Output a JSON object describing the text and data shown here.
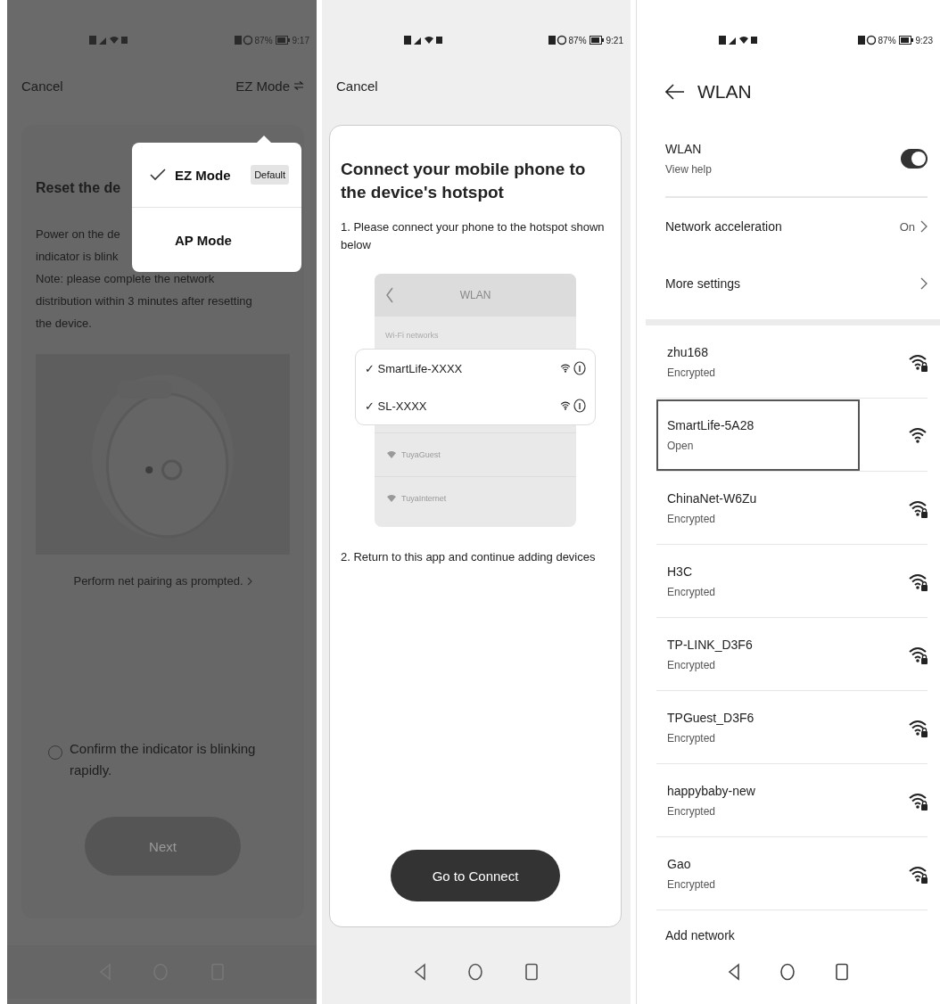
{
  "screens": [
    {
      "kind": "reset",
      "status_bar": {
        "battery_text": "87%",
        "time": "9:17"
      },
      "cancel": "Cancel",
      "mode_button": "EZ Mode",
      "card": {
        "title": "Reset the de",
        "lines": [
          "Power on the de",
          "indicator is blink",
          "Note: please complete the network",
          "distribution within 3 minutes after resetting",
          "the device."
        ],
        "help_link": "Perform net pairing as prompted.",
        "confirm": {
          "label": "Confirm the indicator is blinking rapidly.",
          "checked": false
        },
        "next_button": {
          "label": "Next",
          "disabled": true
        }
      },
      "mode_menu": {
        "options": [
          {
            "label": "EZ Mode",
            "selected": true,
            "badge": "Default"
          },
          {
            "label": "AP Mode",
            "selected": false
          }
        ]
      }
    },
    {
      "kind": "hotspot",
      "status_bar": {
        "battery_text": "87%",
        "time": "9:21"
      },
      "cancel": "Cancel",
      "card": {
        "title": "Connect your mobile phone to the device's hotspot",
        "step_1": "1. Please connect your phone to the hotspot shown below",
        "illustration": {
          "title": "WLAN",
          "section": "Wi-Fi networks",
          "highlighted": [
            {
              "mark": "✓",
              "name": "SmartLife-XXXX"
            },
            {
              "mark": "✓",
              "name": "SL-XXXX"
            }
          ],
          "others": [
            "TuyaGuest",
            "TuyaInternet"
          ]
        },
        "step_2": "2. Return to this app and continue adding devices",
        "connect_button": "Go to Connect"
      }
    },
    {
      "kind": "wlan",
      "status_bar": {
        "battery_text": "87%",
        "time": "9:23"
      },
      "title": "WLAN",
      "wlan_toggle": {
        "label": "WLAN",
        "sublabel": "View help",
        "on": true
      },
      "settings": [
        {
          "label": "Network acceleration",
          "value": "On"
        },
        {
          "label": "More settings"
        }
      ],
      "networks": [
        {
          "name": "zhu168",
          "security": "Encrypted",
          "locked": true,
          "selected": false
        },
        {
          "name": "SmartLife-5A28",
          "security": "Open",
          "locked": false,
          "selected": true
        },
        {
          "name": "ChinaNet-W6Zu",
          "security": "Encrypted",
          "locked": true,
          "selected": false
        },
        {
          "name": "H3C",
          "security": "Encrypted",
          "locked": true,
          "selected": false
        },
        {
          "name": "TP-LINK_D3F6",
          "security": "Encrypted",
          "locked": true,
          "selected": false
        },
        {
          "name": "TPGuest_D3F6",
          "security": "Encrypted",
          "locked": true,
          "selected": false
        },
        {
          "name": "happybaby-new",
          "security": "Encrypted",
          "locked": true,
          "selected": false
        },
        {
          "name": "Gao",
          "security": "Encrypted",
          "locked": true,
          "selected": false
        }
      ],
      "add_network": "Add network"
    }
  ]
}
